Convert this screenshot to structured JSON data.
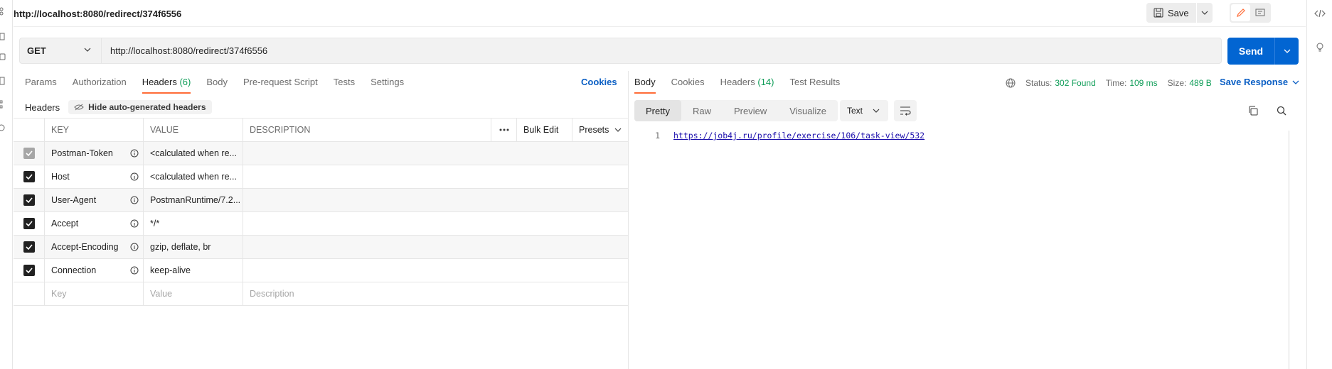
{
  "request": {
    "title": "http://localhost:8080/redirect/374f6556",
    "method": "GET",
    "url": "http://localhost:8080/redirect/374f6556",
    "send_label": "Send",
    "save_label": "Save"
  },
  "request_tabs": [
    {
      "label": "Params"
    },
    {
      "label": "Authorization"
    },
    {
      "label": "Headers",
      "count": "(6)"
    },
    {
      "label": "Body"
    },
    {
      "label": "Pre-request Script"
    },
    {
      "label": "Tests"
    },
    {
      "label": "Settings"
    }
  ],
  "cookies_link": "Cookies",
  "headers_panel": {
    "title": "Headers",
    "hide_auto_label": "Hide auto-generated headers",
    "columns": {
      "key": "KEY",
      "value": "VALUE",
      "description": "DESCRIPTION",
      "bulk_edit": "Bulk Edit",
      "presets": "Presets"
    },
    "rows": [
      {
        "key": "Postman-Token",
        "value": "<calculated when re...",
        "description": "",
        "checked": true,
        "disabled": true
      },
      {
        "key": "Host",
        "value": "<calculated when re...",
        "description": "",
        "checked": true,
        "disabled": false
      },
      {
        "key": "User-Agent",
        "value": "PostmanRuntime/7.2...",
        "description": "",
        "checked": true,
        "disabled": false
      },
      {
        "key": "Accept",
        "value": "*/*",
        "description": "",
        "checked": true,
        "disabled": false
      },
      {
        "key": "Accept-Encoding",
        "value": "gzip, deflate, br",
        "description": "",
        "checked": true,
        "disabled": false
      },
      {
        "key": "Connection",
        "value": "keep-alive",
        "description": "",
        "checked": true,
        "disabled": false
      }
    ],
    "placeholders": {
      "key": "Key",
      "value": "Value",
      "description": "Description"
    }
  },
  "response": {
    "tabs": [
      {
        "label": "Body"
      },
      {
        "label": "Cookies"
      },
      {
        "label": "Headers",
        "count": "(14)"
      },
      {
        "label": "Test Results"
      }
    ],
    "status_label": "Status:",
    "status_value": "302 Found",
    "time_label": "Time:",
    "time_value": "109 ms",
    "size_label": "Size:",
    "size_value": "489 B",
    "save_response_label": "Save Response",
    "formats": [
      "Pretty",
      "Raw",
      "Preview",
      "Visualize"
    ],
    "active_format": "Pretty",
    "language": "Text",
    "lines": [
      {
        "num": "1",
        "text": "https://job4j.ru/profile/exercise/106/task-view/532"
      }
    ]
  },
  "colors": {
    "accent": "#ff6c37",
    "primary": "#0265d2",
    "success": "#0f9d58",
    "link": "#0b5fc4"
  }
}
